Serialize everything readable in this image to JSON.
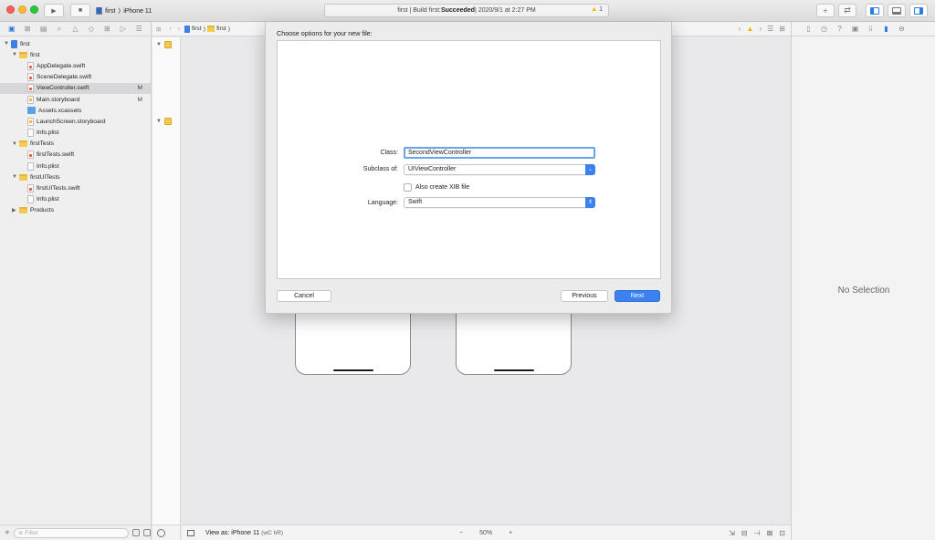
{
  "window": {
    "scheme_target": "first",
    "scheme_device": "iPhone 11",
    "activity": {
      "prefix": "first | Build first: ",
      "status": "Succeeded",
      "suffix": " | 2020/9/1 at 2:27 PM",
      "warning_count": "1"
    }
  },
  "navigator": {
    "tree": [
      {
        "label": "first",
        "kind": "proj",
        "indent": 0,
        "disclosure": "open",
        "badge": "",
        "selected": false
      },
      {
        "label": "first",
        "kind": "folder",
        "indent": 1,
        "disclosure": "open",
        "badge": "",
        "selected": false
      },
      {
        "label": "AppDelegate.swift",
        "kind": "swift",
        "indent": 2,
        "disclosure": "",
        "badge": "",
        "selected": false
      },
      {
        "label": "SceneDelegate.swift",
        "kind": "swift",
        "indent": 2,
        "disclosure": "",
        "badge": "",
        "selected": false
      },
      {
        "label": "ViewController.swift",
        "kind": "swift",
        "indent": 2,
        "disclosure": "",
        "badge": "M",
        "selected": true
      },
      {
        "label": "Main.storyboard",
        "kind": "sb",
        "indent": 2,
        "disclosure": "",
        "badge": "M",
        "selected": false
      },
      {
        "label": "Assets.xcassets",
        "kind": "assets",
        "indent": 2,
        "disclosure": "",
        "badge": "",
        "selected": false
      },
      {
        "label": "LaunchScreen.storyboard",
        "kind": "sb",
        "indent": 2,
        "disclosure": "",
        "badge": "",
        "selected": false
      },
      {
        "label": "Info.plist",
        "kind": "plist",
        "indent": 2,
        "disclosure": "",
        "badge": "",
        "selected": false
      },
      {
        "label": "firstTests",
        "kind": "folder",
        "indent": 1,
        "disclosure": "open",
        "badge": "",
        "selected": false
      },
      {
        "label": "firstTests.swift",
        "kind": "swift",
        "indent": 2,
        "disclosure": "",
        "badge": "",
        "selected": false
      },
      {
        "label": "Info.plist",
        "kind": "plist",
        "indent": 2,
        "disclosure": "",
        "badge": "",
        "selected": false
      },
      {
        "label": "firstUITests",
        "kind": "folder",
        "indent": 1,
        "disclosure": "open",
        "badge": "",
        "selected": false
      },
      {
        "label": "firstUITests.swift",
        "kind": "swift",
        "indent": 2,
        "disclosure": "",
        "badge": "",
        "selected": false
      },
      {
        "label": "Info.plist",
        "kind": "plist",
        "indent": 2,
        "disclosure": "",
        "badge": "",
        "selected": false
      },
      {
        "label": "Products",
        "kind": "folder",
        "indent": 1,
        "disclosure": "closed",
        "badge": "",
        "selected": false
      }
    ],
    "filter_placeholder": "Filter"
  },
  "editor": {
    "breadcrumb": [
      "first",
      "first"
    ],
    "view_as": "View as: iPhone 11",
    "view_as_traits": "(wC hR)",
    "zoom": "50%",
    "zoom_minus": "−",
    "zoom_plus": "+"
  },
  "sheet": {
    "title": "Choose options for your new file:",
    "class_label": "Class:",
    "class_value": "SecondViewController",
    "subclass_label": "Subclass of:",
    "subclass_value": "UIViewController",
    "xib_label": "Also create XIB file",
    "language_label": "Language:",
    "language_value": "Swift",
    "cancel": "Cancel",
    "previous": "Previous",
    "next": "Next"
  },
  "inspector": {
    "empty_text": "No Selection"
  },
  "colors": {
    "accent": "#3b82f0",
    "warning": "#f0b400",
    "close": "#fc5f57",
    "minimize": "#fdbc2e",
    "zoom": "#28c840"
  }
}
